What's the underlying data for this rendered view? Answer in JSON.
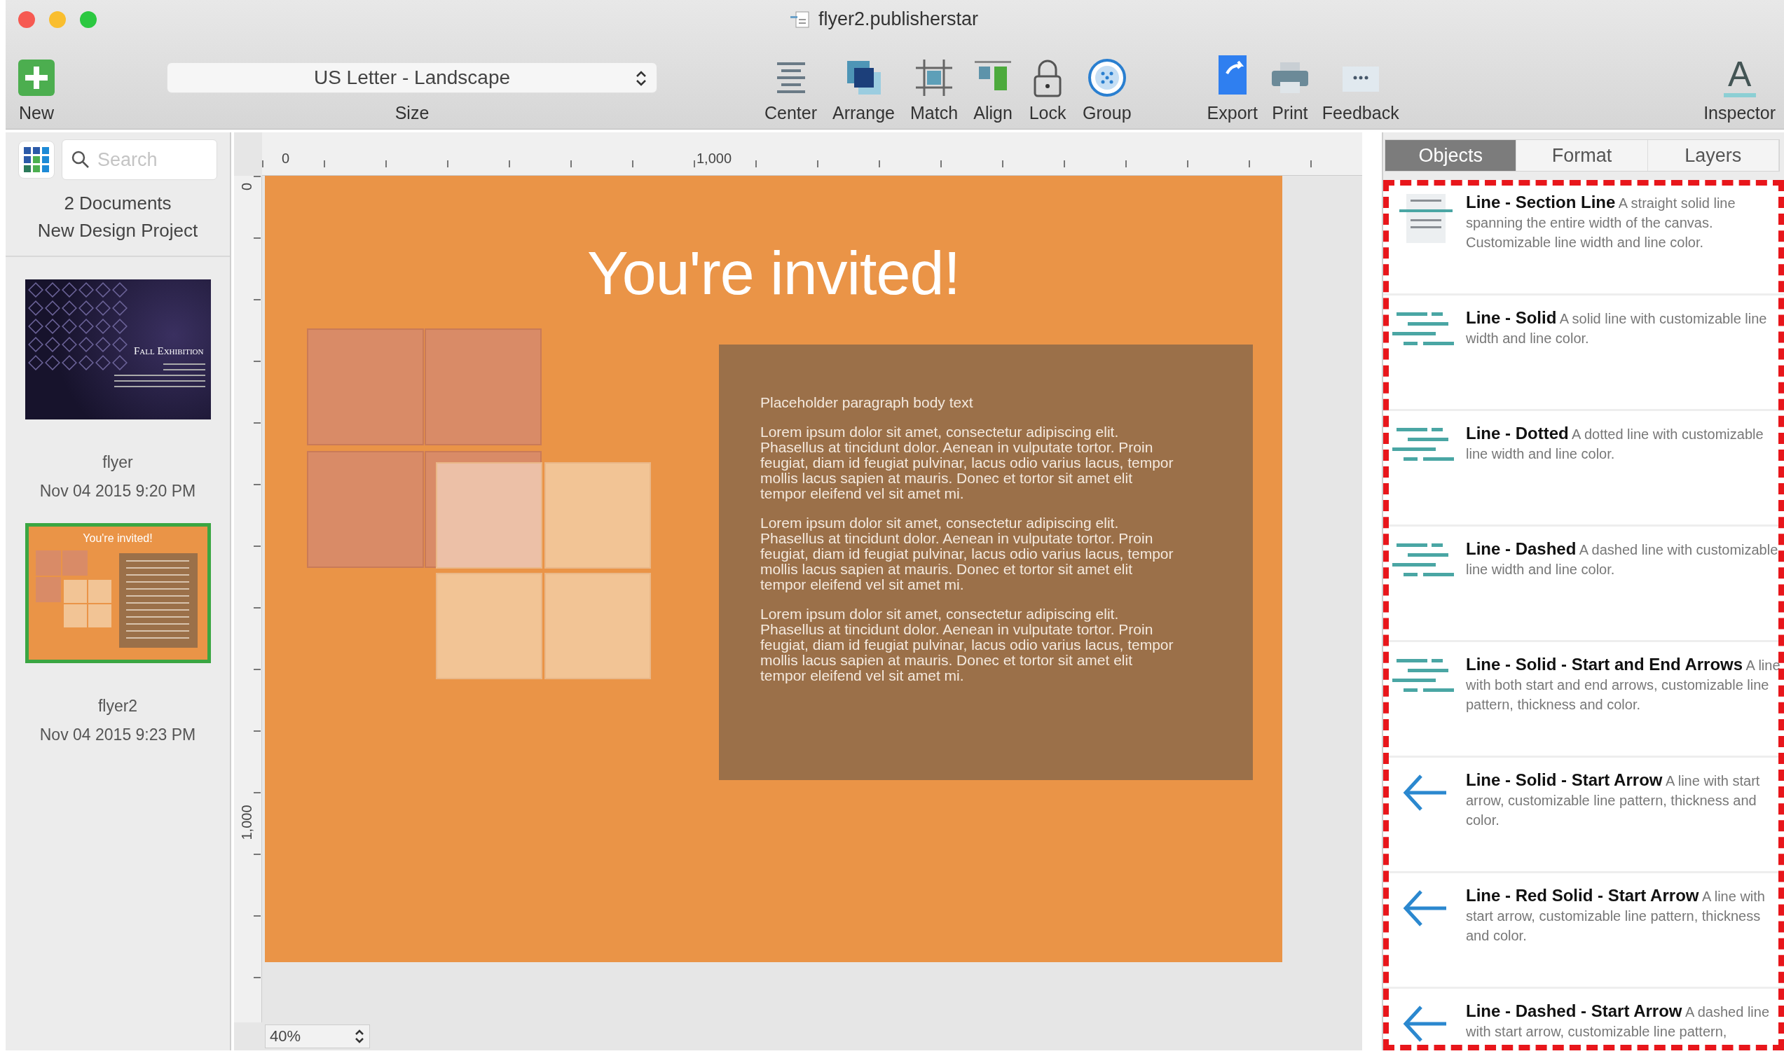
{
  "window": {
    "title": "flyer2.publisherstar"
  },
  "toolbar": {
    "new_button": {
      "label": "New"
    },
    "size": {
      "value": "US Letter - Landscape",
      "label": "Size"
    },
    "arrange_tools": [
      {
        "kind": "center",
        "label": "Center"
      },
      {
        "kind": "arrange",
        "label": "Arrange"
      },
      {
        "kind": "match",
        "label": "Match"
      },
      {
        "kind": "align",
        "label": "Align"
      },
      {
        "kind": "lock",
        "label": "Lock"
      },
      {
        "kind": "group",
        "label": "Group"
      }
    ],
    "output_tools": [
      {
        "kind": "export",
        "label": "Export"
      },
      {
        "kind": "print",
        "label": "Print"
      },
      {
        "kind": "feedback",
        "label": "Feedback"
      }
    ],
    "inspector": {
      "glyph": "A",
      "label": "Inspector"
    }
  },
  "sidebar": {
    "search": {
      "placeholder": "Search"
    },
    "summary": [
      "2 Documents",
      "New Design Project"
    ],
    "documents": [
      {
        "kind": "dark",
        "thumbnail_title": "Fall Exhibition",
        "name": "flyer",
        "date": "Nov 04 2015 9:20 PM",
        "selected": false
      },
      {
        "kind": "orange",
        "thumbnail_title": "You're invited!",
        "name": "flyer2",
        "date": "Nov 04 2015 9:23 PM",
        "selected": true
      }
    ]
  },
  "canvas": {
    "ruler_labels": [
      "0",
      "1,000"
    ],
    "vertical_ruler_labels": [
      "0",
      "1,000"
    ],
    "page": {
      "title": "You're invited!",
      "text_box": {
        "heading": "Placeholder paragraph body text",
        "paragraphs": [
          "Lorem ipsum dolor sit amet, consectetur adipiscing elit. Phasellus at tincidunt dolor. Aenean in vulputate tortor. Proin feugiat, diam id feugiat pulvinar, lacus odio varius lacus, tempor mollis lacus sapien at mauris. Donec et tortor sit amet elit tempor eleifend vel sit amet mi.",
          "Lorem ipsum dolor sit amet, consectetur adipiscing elit. Phasellus at tincidunt dolor. Aenean in vulputate tortor. Proin feugiat, diam id feugiat pulvinar, lacus odio varius lacus, tempor mollis lacus sapien at mauris. Donec et tortor sit amet elit tempor eleifend vel sit amet mi.",
          "Lorem ipsum dolor sit amet, consectetur adipiscing elit. Phasellus at tincidunt dolor. Aenean in vulputate tortor. Proin feugiat, diam id feugiat pulvinar, lacus odio varius lacus, tempor mollis lacus sapien at mauris. Donec et tortor sit amet elit tempor eleifend vel sit amet mi."
        ]
      }
    },
    "zoom": "40%"
  },
  "inspector_panel": {
    "tabs": [
      {
        "label": "Objects",
        "selected": true
      },
      {
        "label": "Format",
        "selected": false
      },
      {
        "label": "Layers",
        "selected": false
      }
    ],
    "objects": [
      {
        "kind": "section",
        "title": "Line - Section Line",
        "description": "A straight solid line spanning the entire width of the canvas. Customizable line width and line color."
      },
      {
        "kind": "lines",
        "title": "Line - Solid",
        "description": "A solid line with customizable line width and line color."
      },
      {
        "kind": "lines",
        "title": "Line - Dotted",
        "description": "A dotted line with customizable line width and line color."
      },
      {
        "kind": "lines",
        "title": "Line - Dashed",
        "description": "A dashed line with customizable line width and line color."
      },
      {
        "kind": "lines",
        "title": "Line - Solid - Start and End Arrows",
        "description": "A line with both start and end arrows, customizable line pattern, thickness and color."
      },
      {
        "kind": "arrow",
        "title": "Line - Solid - Start Arrow",
        "description": "A line with start arrow, customizable line pattern, thickness and color."
      },
      {
        "kind": "arrow",
        "title": "Line - Red Solid - Start Arrow",
        "description": "A line with start arrow, customizable line pattern, thickness and color."
      },
      {
        "kind": "arrow",
        "title": "Line - Dashed - Start Arrow",
        "description": "A dashed line with start arrow, customizable line pattern,"
      }
    ]
  }
}
